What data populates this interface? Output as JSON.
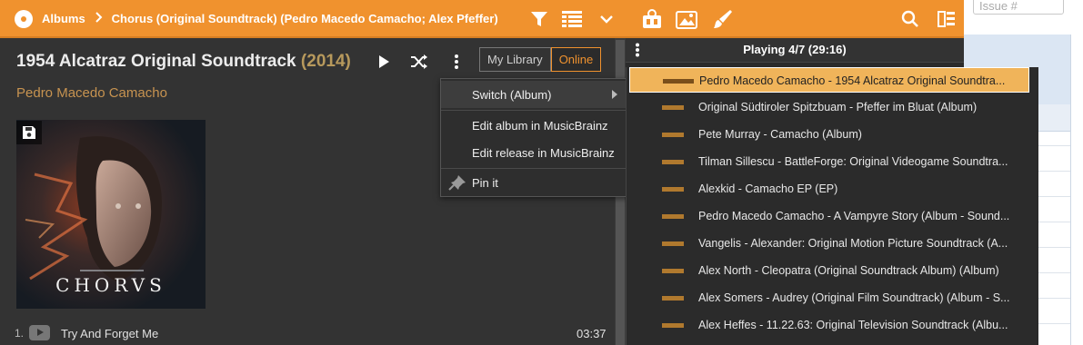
{
  "background": {
    "issue_placeholder": "Issue #"
  },
  "toolbar": {
    "breadcrumb": [
      "Albums",
      "Chorus (Original Soundtrack) (Pedro Macedo Camacho; Alex Pfeffer)"
    ],
    "icons": [
      "filter-icon",
      "list-view-icon",
      "chevron-down-icon",
      "toolkit-icon",
      "image-icon",
      "brush-icon",
      "search-icon",
      "panel-toggle-icon"
    ],
    "accent_color": "#f0922e"
  },
  "album": {
    "title": "1954 Alcatraz Original Soundtrack",
    "year_display": "(2014)",
    "artist": "Pedro Macedo Camacho",
    "cover_text": "CHORVS",
    "source_tabs": {
      "library": "My Library",
      "online": "Online",
      "selected": "Online"
    }
  },
  "menu": {
    "items": [
      "Switch (Album)",
      "Edit album in MusicBrainz",
      "Edit release in MusicBrainz",
      "Pin it"
    ]
  },
  "tracks": [
    {
      "number": "1.",
      "title": "Try And Forget Me",
      "duration": "03:37"
    }
  ],
  "queue": {
    "header": "Playing 4/7 (29:16)",
    "items": [
      "Pedro Macedo Camacho - 1954 Alcatraz Original Soundtra...",
      "Original Südtiroler Spitzbuam - Pfeffer im Bluat (Album)",
      "Pete Murray - Camacho (Album)",
      "Tilman Sillescu - BattleForge: Original Videogame Soundtra...",
      "Alexkid - Camacho EP (EP)",
      "Pedro Macedo Camacho - A Vampyre Story (Album - Sound...",
      "Vangelis - Alexander: Original Motion Picture Soundtrack (A...",
      "Alex North - Cleopatra (Original Soundtrack Album) (Album)",
      "Alex Somers - Audrey (Original Film Soundtrack) (Album - S...",
      "Alex Heffes - 11.22.63: Original Television Soundtrack (Albu..."
    ],
    "active_index": 0
  }
}
